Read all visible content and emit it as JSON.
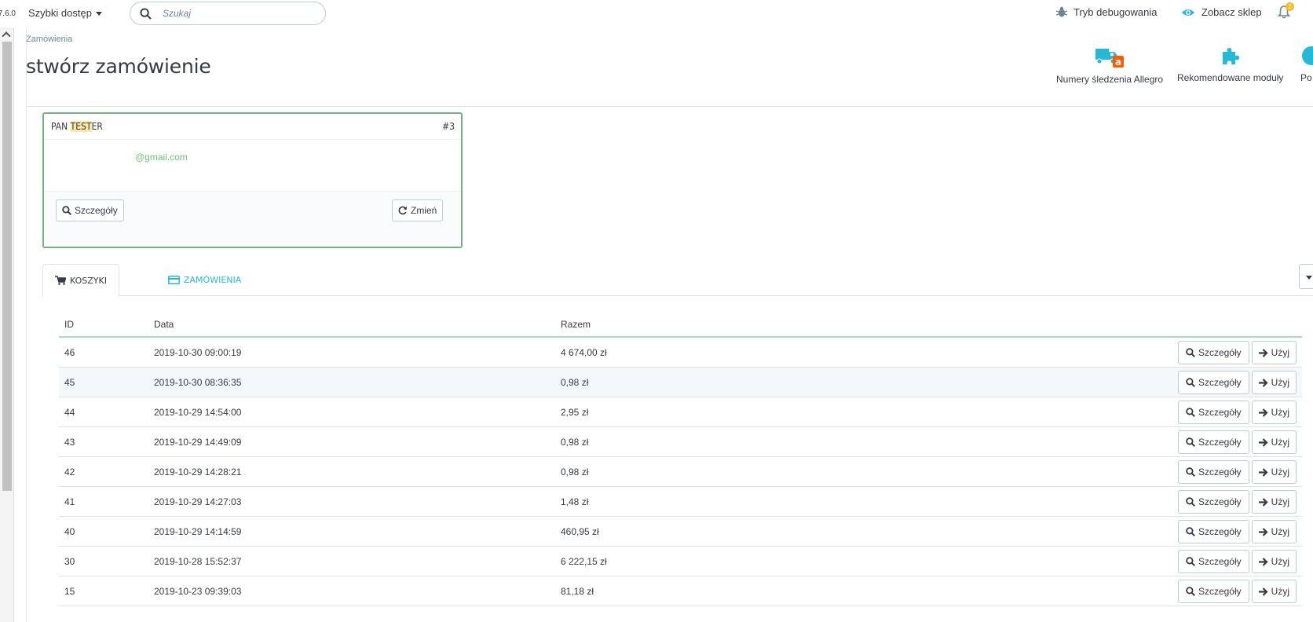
{
  "topbar": {
    "version": "7.6.0",
    "quick_access": "Szybki dostęp",
    "search_placeholder": "Szukaj",
    "debug_mode": "Tryb debugowania",
    "view_shop": "Zobacz sklep",
    "notifications_count": "2"
  },
  "header": {
    "breadcrumb": "Zamówienia",
    "title": "stwórz zamówienie",
    "toolbar": [
      {
        "label": "Numery śledzenia Allegro",
        "icon": "truck-allegro-icon"
      },
      {
        "label": "Rekomendowane moduły",
        "icon": "puzzle-icon"
      },
      {
        "label": "Po",
        "icon": "help-icon"
      }
    ]
  },
  "customer": {
    "name_prefix": "PAN ",
    "name_highlight": "TEST",
    "name_suffix": "ER",
    "id": "#3",
    "email": "@gmail.com",
    "details_button": "Szczegóły",
    "change_button": "Zmień"
  },
  "tabs": {
    "carts": "KOSZYKI",
    "orders": "ZAMÓWIENIA"
  },
  "table": {
    "headers": {
      "id": "ID",
      "date": "Data",
      "total": "Razem"
    },
    "details_label": "Szczegóły",
    "use_label": "Użyj",
    "rows": [
      {
        "id": "46",
        "date": "2019-10-30 09:00:19",
        "total": "4 674,00 zł"
      },
      {
        "id": "45",
        "date": "2019-10-30 08:36:35",
        "total": "0,98 zł"
      },
      {
        "id": "44",
        "date": "2019-10-29 14:54:00",
        "total": "2,95 zł"
      },
      {
        "id": "43",
        "date": "2019-10-29 14:49:09",
        "total": "0,98 zł"
      },
      {
        "id": "42",
        "date": "2019-10-29 14:28:21",
        "total": "0,98 zł"
      },
      {
        "id": "41",
        "date": "2019-10-29 14:27:03",
        "total": "1,48 zł"
      },
      {
        "id": "40",
        "date": "2019-10-29 14:14:59",
        "total": "460,95 zł"
      },
      {
        "id": "30",
        "date": "2019-10-28 15:52:37",
        "total": "6 222,15 zł"
      },
      {
        "id": "15",
        "date": "2019-10-23 09:39:03",
        "total": "81,18 zł"
      }
    ]
  },
  "colors": {
    "accent": "#25b9d7",
    "card_border": "#70b580",
    "email": "#72c279",
    "highlight": "#fbe7a6",
    "allegro_orange": "#ff5a00"
  }
}
